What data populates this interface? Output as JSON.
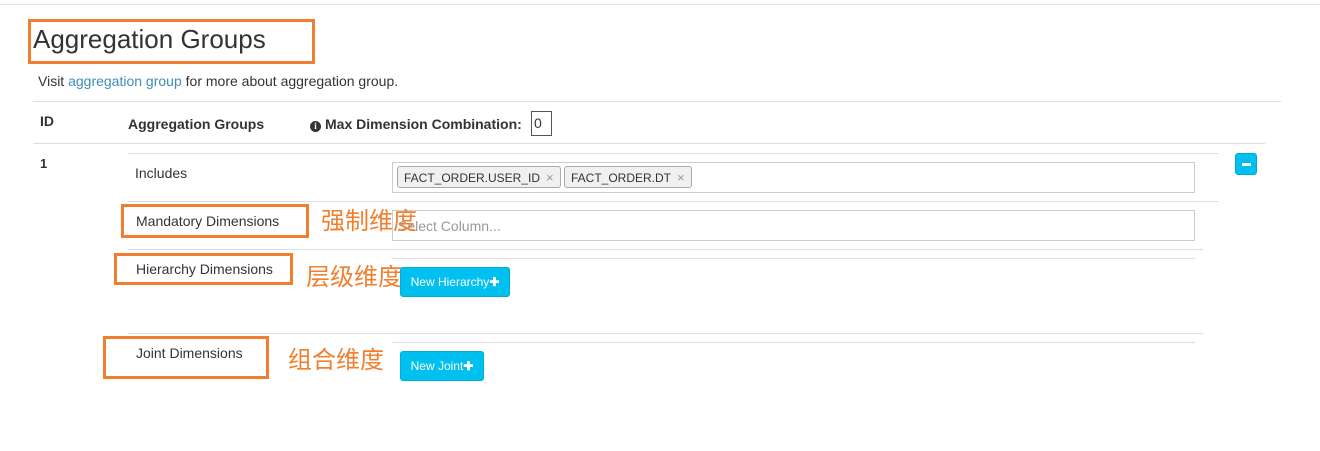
{
  "header": {
    "title": "Aggregation Groups",
    "hint_prefix": "Visit ",
    "hint_link": "aggregation group",
    "hint_suffix": " for more about aggregation group."
  },
  "table": {
    "col_id": "ID",
    "col_groups": "Aggregation Groups",
    "col_max_combo": "Max Dimension Combination:",
    "max_combo_value": "0"
  },
  "group": {
    "id": "1",
    "includes_label": "Includes",
    "includes_tags": [
      "FACT_ORDER.USER_ID",
      "FACT_ORDER.DT"
    ],
    "mandatory_label": "Mandatory Dimensions",
    "mandatory_placeholder": "Select Column...",
    "hierarchy_label": "Hierarchy Dimensions",
    "new_hierarchy_button": "New Hierarchy",
    "joint_label": "Joint Dimensions",
    "new_joint_button": "New Joint"
  },
  "annotations": {
    "mandatory": "强制维度",
    "hierarchy": "层级维度",
    "joint": "组合维度",
    "color": "#f08030"
  },
  "icons": {
    "info": "info-circle-icon",
    "remove_tag": "close-icon",
    "plus": "plus-icon",
    "minus": "minus-icon"
  },
  "colors": {
    "accent": "#00c0ef",
    "link": "#3c8dbc"
  }
}
